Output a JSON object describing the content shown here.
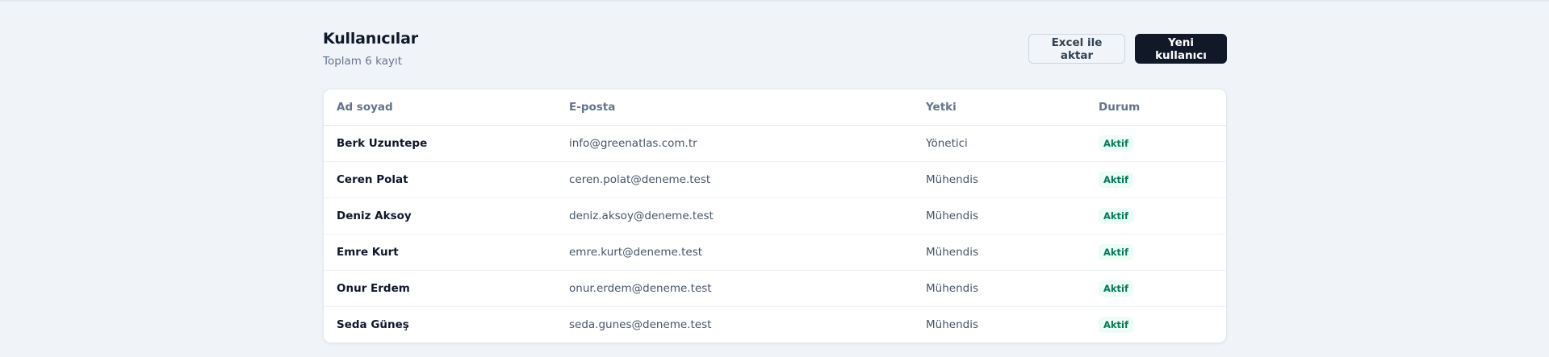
{
  "page": {
    "title": "Kullanıcılar",
    "subtitle": "Toplam 6 kayıt"
  },
  "actions": {
    "export_label": "Excel ile aktar",
    "new_user_label": "Yeni kullanıcı"
  },
  "table": {
    "columns": [
      "Ad soyad",
      "E-posta",
      "Yetki",
      "Durum"
    ],
    "rows": [
      {
        "name": "Berk Uzuntepe",
        "email": "info@greenatlas.com.tr",
        "role": "Yönetici",
        "status": "Aktif"
      },
      {
        "name": "Ceren Polat",
        "email": "ceren.polat@deneme.test",
        "role": "Mühendis",
        "status": "Aktif"
      },
      {
        "name": "Deniz Aksoy",
        "email": "deniz.aksoy@deneme.test",
        "role": "Mühendis",
        "status": "Aktif"
      },
      {
        "name": "Emre Kurt",
        "email": "emre.kurt@deneme.test",
        "role": "Mühendis",
        "status": "Aktif"
      },
      {
        "name": "Onur Erdem",
        "email": "onur.erdem@deneme.test",
        "role": "Mühendis",
        "status": "Aktif"
      },
      {
        "name": "Seda Güneş",
        "email": "seda.gunes@deneme.test",
        "role": "Mühendis",
        "status": "Aktif"
      }
    ]
  },
  "colors": {
    "background": "#f0f4f8",
    "primary_button": "#111827",
    "status_active_bg": "#ecfdf5",
    "status_active_text": "#047857"
  }
}
